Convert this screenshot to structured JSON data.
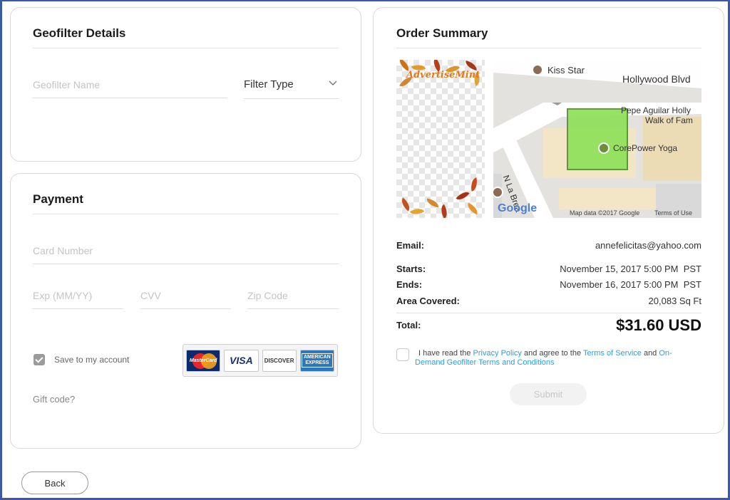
{
  "geofilter": {
    "title": "Geofilter Details",
    "name_placeholder": "Geofilter Name",
    "filter_type_label": "Filter Type"
  },
  "payment": {
    "title": "Payment",
    "card_number_placeholder": "Card Number",
    "exp_placeholder": "Exp (MM/YY)",
    "cvv_placeholder": "CVV",
    "zip_placeholder": "Zip Code",
    "save_label": "Save to my account",
    "save_checked": true,
    "gift_code_label": "Gift code?",
    "card_logos": {
      "mastercard": "MasterCard",
      "visa": "VISA",
      "discover": "DISCOVER",
      "amex_line1": "AMERICAN",
      "amex_line2": "EXPRESS"
    }
  },
  "order": {
    "title": "Order Summary",
    "preview_brand": "AdvertiseMint",
    "map": {
      "kiss_star": "Kiss Star",
      "hollywood_blvd": "Hollywood Blvd",
      "pepe_line1": "Pepe Aguilar Holly",
      "pepe_line2": "Walk of Fam",
      "corepower": "CorePower Yoga",
      "la_brea": "N La Brea",
      "google": "Google",
      "map_data": "Map data ©2017 Google",
      "terms": "Terms of Use"
    },
    "email_label": "Email:",
    "email_value": "annefelicitas@yahoo.com",
    "starts_label": "Starts:",
    "starts_value": "November 15, 2017 5:00 PM  PST",
    "ends_label": "Ends:",
    "ends_value": "November 16, 2017 5:00 PM  PST",
    "area_label": "Area Covered:",
    "area_value": "20,083 Sq Ft",
    "total_label": "Total:",
    "total_value": "$31.60 USD",
    "legal": {
      "prefix": "I have read the ",
      "privacy": "Privacy Policy",
      "middle": " and agree to the ",
      "terms": "Terms of Service",
      "and": " and ",
      "ondemand": "On-Demand Geofilter Terms and Conditions"
    },
    "submit_label": "Submit"
  },
  "back_label": "Back",
  "colors": {
    "link": "#2f9fe0",
    "frame": "#3a5aa8",
    "geofence": "#8fe05a"
  }
}
